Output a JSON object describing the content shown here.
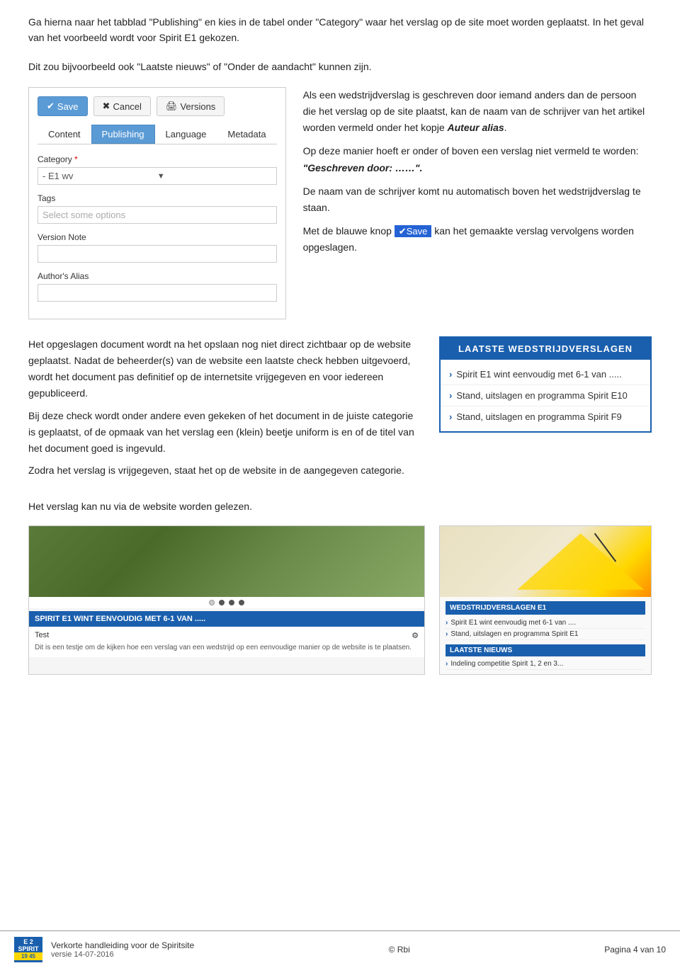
{
  "intro": {
    "text1": "Ga hierna naar het tabblad \"Publishing\" en kies in de tabel onder \"Category\" waar het verslag op de site moet worden geplaatst. In het geval van het voorbeeld wordt voor Spirit E1 gekozen.",
    "text2": "Dit zou bijvoorbeeld ook \"Laatste nieuws\" of \"Onder de aandacht\" kunnen zijn."
  },
  "cms": {
    "save_label": "Save",
    "cancel_label": "Cancel",
    "versions_label": "Versions",
    "tab_content": "Content",
    "tab_publishing": "Publishing",
    "tab_language": "Language",
    "tab_metadata": "Metadata",
    "category_label": "Category",
    "category_required": "*",
    "category_value": "- E1 wv",
    "tags_label": "Tags",
    "tags_placeholder": "Select some options",
    "version_note_label": "Version Note",
    "author_alias_label": "Author's Alias"
  },
  "right_col": {
    "para1": "Als een wedstrijdverslag is geschreven door iemand anders dan de persoon die het verslag op de site plaatst, kan de naam van de schrijver van het artikel worden vermeld onder het kopje ",
    "auteur_alias": "Auteur alias",
    "para1_end": ".",
    "para2_prefix": "Op deze manier hoeft er onder of boven een verslag niet vermeld te worden: ",
    "geschreven_door": "\"Geschreven door: ……\".",
    "para3": "De naam van de schrijver komt nu automatisch boven het wedstrijdverslag te staan.",
    "para4_prefix": "Met de blauwe knop ",
    "save_highlight": "✔Save",
    "para4_suffix": " kan het gemaakte verslag vervolgens worden opgeslagen."
  },
  "bottom_left": {
    "para1": "Het opgeslagen document wordt na het opslaan nog niet direct zichtbaar op de website geplaatst. Nadat de beheerder(s) van de website een laatste check hebben uitgevoerd, wordt het document pas definitief op de internetsite vrijgegeven en voor iedereen gepubliceerd.",
    "para2": "Bij deze check wordt onder andere even gekeken of het document in de juiste categorie is geplaatst, of de opmaak van het verslag een (klein) beetje uniform is en of de titel van het document goed is ingevuld.",
    "para3": "Zodra het verslag is vrijgegeven, staat het op de website in de aangegeven categorie.",
    "para4": "Het verslag kan nu via de website worden gelezen."
  },
  "widget": {
    "header": "LAATSTE WEDSTRIJDVERSLAGEN",
    "items": [
      "Spirit E1 wint eenvoudig met 6-1 van .....",
      "Stand, uitslagen en programma Spirit E10",
      "Stand, uitslagen en programma Spirit F9"
    ]
  },
  "screenshot_left": {
    "dots": [
      "empty",
      "filled",
      "filled",
      "filled"
    ],
    "headline": "SPIRIT E1 WINT EENVOUDIG MET 6-1 VAN .....",
    "test_label": "Test",
    "gear_icon": "⚙",
    "description": "Dit is een testje om de kijken hoe een verslag van een wedstrijd op een eenvoudige manier op de website is te plaatsen."
  },
  "screenshot_right": {
    "sidebar_title": "WEDSTRIJDVERSLAGEN E1",
    "items": [
      "Spirit E1 wint eenvoudig met 6-1 van ....",
      "Stand, uitslagen en programma Spirit E1"
    ],
    "news_label": "LAATSTE NIEUWS",
    "news_item": "Indeling competitie Spirit 1, 2 en 3..."
  },
  "footer": {
    "logo_line1": "E  2",
    "logo_line2": "SPIRIT",
    "logo_time": "19  45",
    "title": "Verkorte handleiding voor de Spiritsite",
    "subtitle": "versie 14-07-2016",
    "copyright": "© Rbi",
    "page": "Pagina 4 van 10"
  }
}
